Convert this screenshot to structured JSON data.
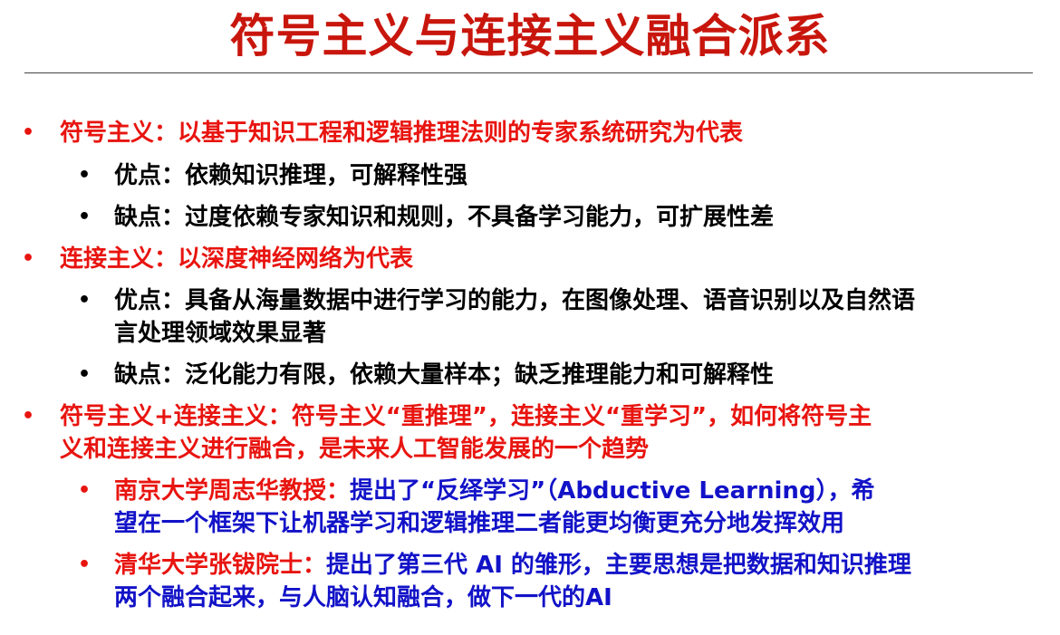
{
  "slide": {
    "title": "符号主义与连接主义融合派系",
    "items": [
      {
        "text": "符号主义：以基于知识工程和逻辑推理法则的专家系统研究为代表"
      },
      {
        "text": "优点：依赖知识推理，可解释性强"
      },
      {
        "text": "缺点：过度依赖专家知识和规则，不具备学习能力，可扩展性差"
      },
      {
        "text": "连接主义：以深度神经网络为代表"
      },
      {
        "line1": "优点：具备从海量数据中进行学习的能力，在图像处理、语音识别以及自然语",
        "line2": "言处理领域效果显著"
      },
      {
        "text": "缺点：泛化能力有限，依赖大量样本；缺乏推理能力和可解释性"
      },
      {
        "line1": "符号主义+连接主义：符号主义“重推理”，连接主义“重学习”，如何将符号主",
        "line2": "义和连接主义进行融合，是未来人工智能发展的一个趋势"
      },
      {
        "label": "南京大学周志华教授：",
        "line1": "提出了“反绎学习”（Abductive Learning），希",
        "line2": "望在一个框架下让机器学习和逻辑推理二者能更均衡更充分地发挥效用"
      },
      {
        "label": "清华大学张钹院士：",
        "line1": "提出了第三代 AI 的雏形，主要思想是把数据和知识推理",
        "line2": "两个融合起来，与人脑认知融合，做下一代的AI"
      }
    ]
  },
  "colors": {
    "title": "#c8160d",
    "level1": "#e8140f",
    "level2": "#000000",
    "highlight_label": "#e8140f",
    "highlight_body": "#1212c8"
  }
}
